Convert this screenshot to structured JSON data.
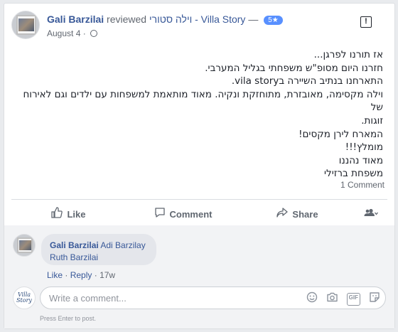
{
  "post": {
    "reviewer": "Gali Barzilai",
    "action": "reviewed",
    "page": "וילה סטורי - Villa Story",
    "dash": "—",
    "rating": "5★",
    "date": "August 4 ·",
    "privacy_icon": "globe-icon",
    "report_icon": "report-icon",
    "review_lines": [
      "אז תורנו לפרגן...",
      "חזרנו היום מסופ\"ש משפחתי בגליל המערבי.",
      "התארחנו בנתיב השיירה בvila story.",
      "וילה מקסימה, מאובזרת, מתוחזקת ונקיה. מאוד מותאמת למשפחות עם ילדים וגם לאירוח של",
      "זוגות.",
      "המארח לירן מקסים!",
      "מומלץ!!!",
      "מאוד נהננו",
      "משפחת ברזילי"
    ],
    "comment_count": "1 Comment"
  },
  "actions": {
    "like": "Like",
    "comment": "Comment",
    "share": "Share"
  },
  "comment": {
    "author": "Gali Barzilai",
    "tag1": "Adi Barzilay",
    "tag2": "Ruth Barzilai",
    "like": "Like",
    "sep": "·",
    "reply": "Reply",
    "time": "17w"
  },
  "composer": {
    "logo_top": "Villa",
    "logo_bottom": "Story",
    "placeholder": "Write a comment...",
    "hint": "Press Enter to post."
  }
}
